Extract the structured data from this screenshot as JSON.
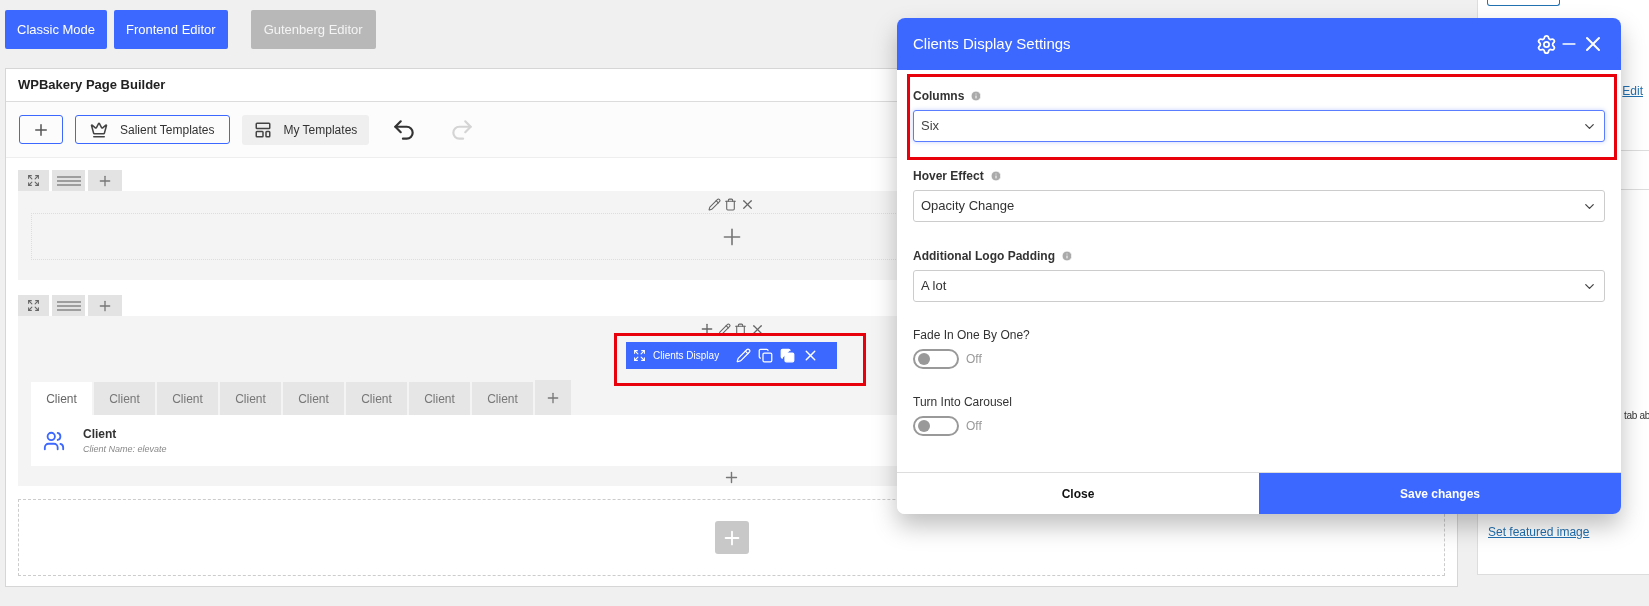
{
  "editor_buttons": [
    {
      "label": "Classic Mode",
      "disabled": false
    },
    {
      "label": "Frontend Editor",
      "disabled": false
    },
    {
      "label": "Gutenberg Editor",
      "disabled": true
    }
  ],
  "builder": {
    "title": "WPBakery Page Builder",
    "templates_button": "Salient Templates",
    "my_templates_button": "My Templates",
    "redo_disabled": true,
    "element": {
      "name": "Clients Display",
      "highlighted": true,
      "tabs": [
        {
          "label": "Client",
          "selected": true
        },
        {
          "label": "Client",
          "selected": false
        },
        {
          "label": "Client",
          "selected": false
        },
        {
          "label": "Client",
          "selected": false
        },
        {
          "label": "Client",
          "selected": false
        },
        {
          "label": "Client",
          "selected": false
        },
        {
          "label": "Client",
          "selected": false
        },
        {
          "label": "Client",
          "selected": false
        }
      ],
      "item": {
        "title": "Client",
        "subtitle": "Client Name: elevate"
      }
    }
  },
  "sidebar": {
    "edit_link": "Edit",
    "text_fragment": "tab ab",
    "featured_image_link": "Set featured image"
  },
  "dialog": {
    "title": "Clients Display Settings",
    "fields": [
      {
        "kind": "select",
        "label": "Columns",
        "value": "Six",
        "info": true,
        "focused": true,
        "highlighted": true
      },
      {
        "kind": "select",
        "label": "Hover Effect",
        "value": "Opacity Change",
        "info": true,
        "focused": false,
        "highlighted": false
      },
      {
        "kind": "select",
        "label": "Additional Logo Padding",
        "value": "A lot",
        "info": true,
        "focused": false,
        "highlighted": false
      },
      {
        "kind": "toggle",
        "label": "Fade In One By One?",
        "on": false,
        "state_text": "Off"
      },
      {
        "kind": "toggle",
        "label": "Turn Into Carousel",
        "on": false,
        "state_text": "Off"
      }
    ],
    "close_button": "Close",
    "save_button": "Save changes"
  }
}
